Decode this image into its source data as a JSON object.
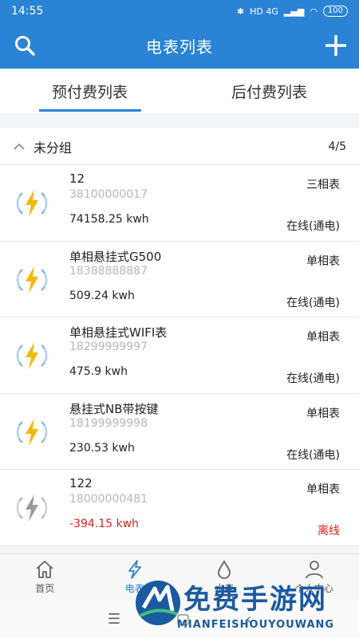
{
  "status_bar": {
    "time": "14:55",
    "network": "HD 4G",
    "battery": "100"
  },
  "app_bar": {
    "title": "电表列表"
  },
  "tabs": [
    {
      "label": "预付费列表",
      "active": true
    },
    {
      "label": "后付费列表",
      "active": false
    }
  ],
  "group": {
    "title": "未分组",
    "count": "4/5"
  },
  "meters": [
    {
      "name": "12",
      "sn": "38100000017",
      "energy": "74158.25 kwh",
      "type": "三相表",
      "status": "在线(通电)",
      "online": true
    },
    {
      "name": "单相悬挂式G500",
      "sn": "18388888887",
      "energy": "509.24 kwh",
      "type": "单相表",
      "status": "在线(通电)",
      "online": true
    },
    {
      "name": "单相悬挂式WIFI表",
      "sn": "18299999997",
      "energy": "475.9 kwh",
      "type": "单相表",
      "status": "在线(通电)",
      "online": true
    },
    {
      "name": "悬挂式NB带按键",
      "sn": "18199999998",
      "energy": "230.53 kwh",
      "type": "单相表",
      "status": "在线(通电)",
      "online": true
    },
    {
      "name": "122",
      "sn": "18000000481",
      "energy": "-394.15 kwh",
      "type": "单相表",
      "status": "离线",
      "online": false
    }
  ],
  "bottom_nav": [
    {
      "label": "首页",
      "icon": "home-icon",
      "active": false
    },
    {
      "label": "电表",
      "icon": "bolt-icon",
      "active": true
    },
    {
      "label": "水表",
      "icon": "water-drop-icon",
      "active": false
    },
    {
      "label": "个人中心",
      "icon": "person-icon",
      "active": false
    }
  ],
  "watermark": {
    "text": "免费手游网",
    "sub": "MIANFEISHOUYOUWANG"
  },
  "colors": {
    "primary": "#2a83d4",
    "danger": "#e0221d",
    "bolt_online": "#f5b800",
    "bolt_offline": "#9a9a9a"
  }
}
